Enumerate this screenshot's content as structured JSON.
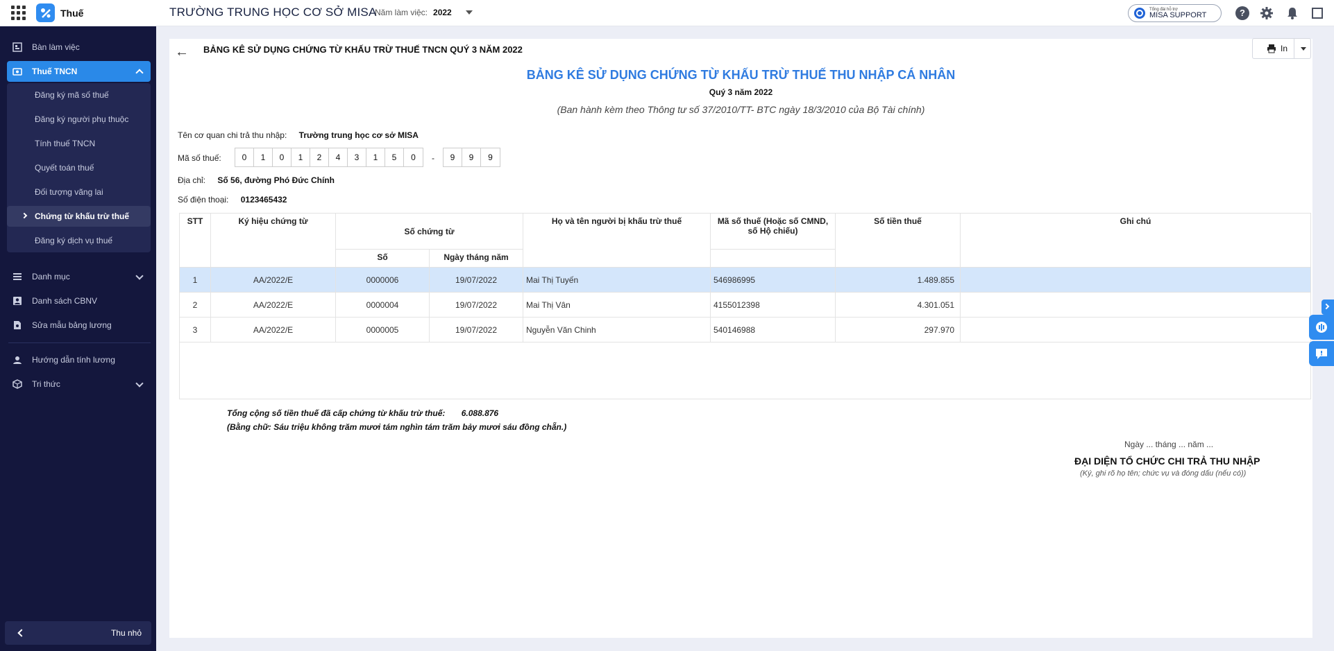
{
  "topbar": {
    "app_name": "Thuế",
    "school_name": "TRƯỜNG TRUNG HỌC CƠ SỞ MISA",
    "year_label": "Năm làm việc:",
    "year_value": "2022",
    "support_small": "Tổng đài hỗ trợ",
    "support_label": "MISA SUPPORT"
  },
  "sidebar": {
    "items": [
      {
        "label": "Bàn làm việc"
      },
      {
        "label": "Thuế TNCN"
      },
      {
        "label": "Danh mục"
      },
      {
        "label": "Danh sách CBNV"
      },
      {
        "label": "Sửa mẫu bảng lương"
      },
      {
        "label": "Hướng dẫn tính lương"
      },
      {
        "label": "Tri thức"
      }
    ],
    "sub_items": [
      {
        "label": "Đăng ký mã số thuế"
      },
      {
        "label": "Đăng ký người phụ thuộc"
      },
      {
        "label": "Tính thuế TNCN"
      },
      {
        "label": "Quyết toán thuế"
      },
      {
        "label": "Đối tượng vãng lai"
      },
      {
        "label": "Chứng từ khấu trừ thuế"
      },
      {
        "label": "Đăng ký dịch vụ thuế"
      }
    ],
    "collapse_label": "Thu nhỏ"
  },
  "page": {
    "title": "BẢNG KÊ SỬ DỤNG CHỨNG TỪ KHẤU TRỪ THUẾ TNCN QUÝ 3 NĂM 2022",
    "print_label": "In"
  },
  "document": {
    "title": "BẢNG KÊ SỬ DỤNG CHỨNG TỪ KHẤU TRỪ THUẾ THU NHẬP CÁ NHÂN",
    "quarter": "Quý 3 năm 2022",
    "note": "(Ban hành kèm theo Thông tư số 37/2010/TT- BTC ngày 18/3/2010 của Bộ Tài chính)",
    "payer_label": "Tên cơ quan chi trả thu nhập:",
    "payer_value": "Trường trung học cơ sở MISA",
    "tax_code_label": "Mã số thuế:",
    "tax_code_digits": [
      "0",
      "1",
      "0",
      "1",
      "2",
      "4",
      "3",
      "1",
      "5",
      "0"
    ],
    "tax_code_sep": "-",
    "tax_code_suffix": [
      "9",
      "9",
      "9"
    ],
    "address_label": "Địa chỉ:",
    "address_value": "Số 56, đường Phó Đức Chính",
    "phone_label": "Số điện thoại:",
    "phone_value": "0123465432"
  },
  "table": {
    "headers": {
      "stt": "STT",
      "symbol": "Ký hiệu chứng từ",
      "doc_no_group": "Số chứng từ",
      "number": "Số",
      "date": "Ngày tháng năm",
      "name": "Họ và tên người bị khấu trừ thuế",
      "tax_code": "Mã số thuế (Hoặc số CMND, số Hộ chiếu)",
      "amount": "Số tiền thuế",
      "note": "Ghi chú"
    },
    "rows": [
      {
        "stt": "1",
        "symbol": "AA/2022/E",
        "number": "0000006",
        "date": "19/07/2022",
        "name": "Mai Thị Tuyến",
        "tax_code": "546986995",
        "amount": "1.489.855",
        "note": ""
      },
      {
        "stt": "2",
        "symbol": "AA/2022/E",
        "number": "0000004",
        "date": "19/07/2022",
        "name": "Mai Thị Vân",
        "tax_code": "4155012398",
        "amount": "4.301.051",
        "note": ""
      },
      {
        "stt": "3",
        "symbol": "AA/2022/E",
        "number": "0000005",
        "date": "19/07/2022",
        "name": "Nguyễn Văn Chinh",
        "tax_code": "540146988",
        "amount": "297.970",
        "note": ""
      }
    ]
  },
  "summary": {
    "total_label": "Tổng cộng số tiền thuế đã cấp chứng từ khấu trừ thuế:",
    "total_value": "6.088.876",
    "words": "(Bằng chữ: Sáu triệu không trăm mươi tám nghìn tám trăm bảy mươi sáu đồng chẵn.)"
  },
  "signature": {
    "date_line": "Ngày ... tháng ... năm ...",
    "rep": "ĐẠI DIỆN TỔ CHỨC CHI TRẢ THU NHẬP",
    "sign_note": "(Ký, ghi rõ họ tên; chức vụ và đóng dấu (nếu có))"
  },
  "colors": {
    "accent": "#2f8cf0",
    "sidebar_bg": "#14173d",
    "title_blue": "#2f7be0",
    "row_highlight": "#d4e6fb"
  }
}
